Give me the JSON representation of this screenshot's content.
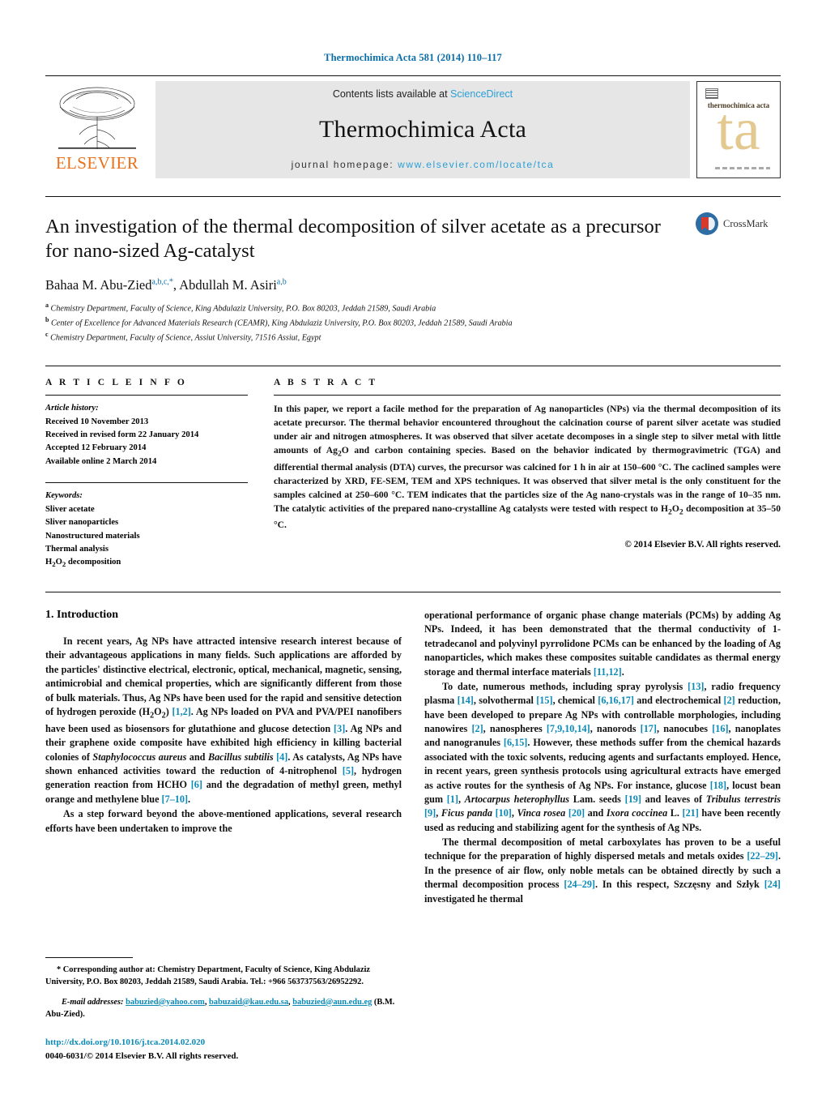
{
  "running_head": "Thermochimica Acta 581 (2014) 110–117",
  "masthead": {
    "contents_prefix": "Contents lists available at ",
    "sciencedirect": "ScienceDirect",
    "journal_title": "Thermochimica Acta",
    "homepage_label": "journal homepage: ",
    "homepage_url": "www.elsevier.com/locate/tca",
    "publisher": "ELSEVIER",
    "cover_title": "thermochimica acta",
    "cover_monogram": "ta"
  },
  "article": {
    "title": "An investigation of the thermal decomposition of silver acetate as a precursor for nano-sized Ag-catalyst",
    "authors_html": "Bahaa M. Abu-Zied<sup>a,b,c,*</sup>, Abdullah M. Asiri<sup>a,b</sup>",
    "affiliations": [
      "Chemistry Department, Faculty of Science, King Abdulaziz University, P.O. Box 80203, Jeddah 21589, Saudi Arabia",
      "Center of Excellence for Advanced Materials Research (CEAMR), King Abdulaziz University, P.O. Box 80203, Jeddah 21589, Saudi Arabia",
      "Chemistry Department, Faculty of Science, Assiut University, 71516 Assiut, Egypt"
    ],
    "affiliation_marks": [
      "a",
      "b",
      "c"
    ],
    "crossmark_label": "CrossMark"
  },
  "article_info": {
    "heading": "A R T I C L E    I N F O",
    "history_title": "Article history:",
    "history": [
      "Received 10 November 2013",
      "Received in revised form 22 January 2014",
      "Accepted 12 February 2014",
      "Available online 2 March 2014"
    ],
    "keywords_title": "Keywords:",
    "keywords": [
      "Sliver acetate",
      "Sliver nanoparticles",
      "Nanostructured materials",
      "Thermal analysis",
      "H2O2 decomposition"
    ]
  },
  "abstract": {
    "heading": "A B S T R A C T",
    "text_html": "In this paper, we report a facile method for the preparation of Ag nanoparticles (NPs) via the thermal decomposition of its acetate precursor. The thermal behavior encountered throughout the calcination course of parent silver acetate was studied under air and nitrogen atmospheres. It was observed that silver acetate decomposes in a single step to silver metal with little amounts of Ag<sub>2</sub>O and carbon containing species. Based on the behavior indicated by thermogravimetric (TGA) and differential thermal analysis (DTA) curves, the precursor was calcined for 1 h in air at 150–600 °C. The caclined samples were characterized by XRD, FE-SEM, TEM and XPS techniques. It was observed that silver metal is the only constituent for the samples calcined at 250–600 °C. TEM indicates that the particles size of the Ag nano-crystals was in the range of 10–35 nm. The catalytic activities of the prepared nano-crystalline Ag catalysts were tested with respect to H<sub>2</sub>O<sub>2</sub> decomposition at 35–50 °C.",
    "copyright": "© 2014 Elsevier B.V. All rights reserved."
  },
  "introduction": {
    "heading": "1. Introduction",
    "left_paragraphs_html": [
      "In recent years, Ag NPs have attracted intensive research interest because of their advantageous applications in many fields. Such applications are afforded by the particles' distinctive electrical, electronic, optical, mechanical, magnetic, sensing, antimicrobial and chemical properties, which are significantly different from those of bulk materials. Thus, Ag NPs have been used for the rapid and sensitive detection of hydrogen peroxide (H<sub>2</sub>O<sub>2</sub>) <span class=\"ref\">[1,2]</span>. Ag NPs loaded on PVA and PVA/PEI nanofibers have been used as biosensors for glutathione and glucose detection <span class=\"ref\">[3]</span>. Ag NPs and their graphene oxide composite have exhibited high efficiency in killing bacterial colonies of <span class=\"it\">Staphylococcus aureus</span> and <span class=\"it\">Bacillus subtilis</span> <span class=\"ref\">[4]</span>. As catalysts, Ag NPs have shown enhanced activities toward the reduction of 4-nitrophenol <span class=\"ref\">[5]</span>, hydrogen generation reaction from HCHO <span class=\"ref\">[6]</span> and the degradation of methyl green, methyl orange and methylene blue <span class=\"ref\">[7–10]</span>.",
      "As a step forward beyond the above-mentioned applications, several research efforts have been undertaken to improve the"
    ],
    "right_paragraphs_html": [
      "operational performance of organic phase change materials (PCMs) by adding Ag NPs. Indeed, it has been demonstrated that the thermal conductivity of 1-tetradecanol and polyvinyl pyrrolidone PCMs can be enhanced by the loading of Ag nanoparticles, which makes these composites suitable candidates as thermal energy storage and thermal interface materials <span class=\"ref\">[11,12]</span>.",
      "To date, numerous methods, including spray pyrolysis <span class=\"ref\">[13]</span>, radio frequency plasma <span class=\"ref\">[14]</span>, solvothermal <span class=\"ref\">[15]</span>, chemical <span class=\"ref\">[6,16,17]</span> and electrochemical <span class=\"ref\">[2]</span> reduction, have been developed to prepare Ag NPs with controllable morphologies, including nanowires <span class=\"ref\">[2]</span>, nanospheres <span class=\"ref\">[7,9,10,14]</span>, nanorods <span class=\"ref\">[17]</span>, nanocubes <span class=\"ref\">[16]</span>, nanoplates and nanogranules <span class=\"ref\">[6,15]</span>. However, these methods suffer from the chemical hazards associated with the toxic solvents, reducing agents and surfactants employed. Hence, in recent years, green synthesis protocols using agricultural extracts have emerged as active routes for the synthesis of Ag NPs. For instance, glucose <span class=\"ref\">[18]</span>, locust bean gum <span class=\"ref\">[1]</span>, <span class=\"it\">Artocarpus heterophyllus</span> Lam. seeds <span class=\"ref\">[19]</span> and leaves of <span class=\"it\">Tribulus terrestris</span> <span class=\"ref\">[9]</span>, <span class=\"it\">Ficus panda</span> <span class=\"ref\">[10]</span>, <span class=\"it\">Vinca rosea</span> <span class=\"ref\">[20]</span> and <span class=\"it\">Ixora coccinea</span> L. <span class=\"ref\">[21]</span> have been recently used as reducing and stabilizing agent for the synthesis of Ag NPs.",
      "The thermal decomposition of metal carboxylates has proven to be a useful technique for the preparation of highly dispersed metals and metals oxides <span class=\"ref\">[22–29]</span>. In the presence of air flow, only noble metals can be obtained directly by such a thermal decomposition process <span class=\"ref\">[24–29]</span>. In this respect, Szczęsny and Szłyk <span class=\"ref\">[24]</span> investigated he thermal"
    ]
  },
  "footnotes": {
    "corresponding_html": "* Corresponding author at: Chemistry Department, Faculty of Science, King Abdulaziz University, P.O. Box 80203, Jeddah 21589, Saudi Arabia. Tel.: +966 563737563/26952292.",
    "email_label": "E-mail addresses:",
    "emails": [
      "babuzied@yahoo.com",
      "babuzaid@kau.edu.sa",
      "babuzied@aun.edu.eg"
    ],
    "email_owner": "(B.M. Abu-Zied).",
    "doi": "http://dx.doi.org/10.1016/j.tca.2014.02.020",
    "issn_line": "0040-6031/© 2014 Elsevier B.V. All rights reserved."
  },
  "colors": {
    "link_blue": "#0b8ab8",
    "sciencedirect_blue": "#2a9fd6",
    "elsevier_orange": "#E9711C",
    "cover_tan": "#e3c88f"
  }
}
